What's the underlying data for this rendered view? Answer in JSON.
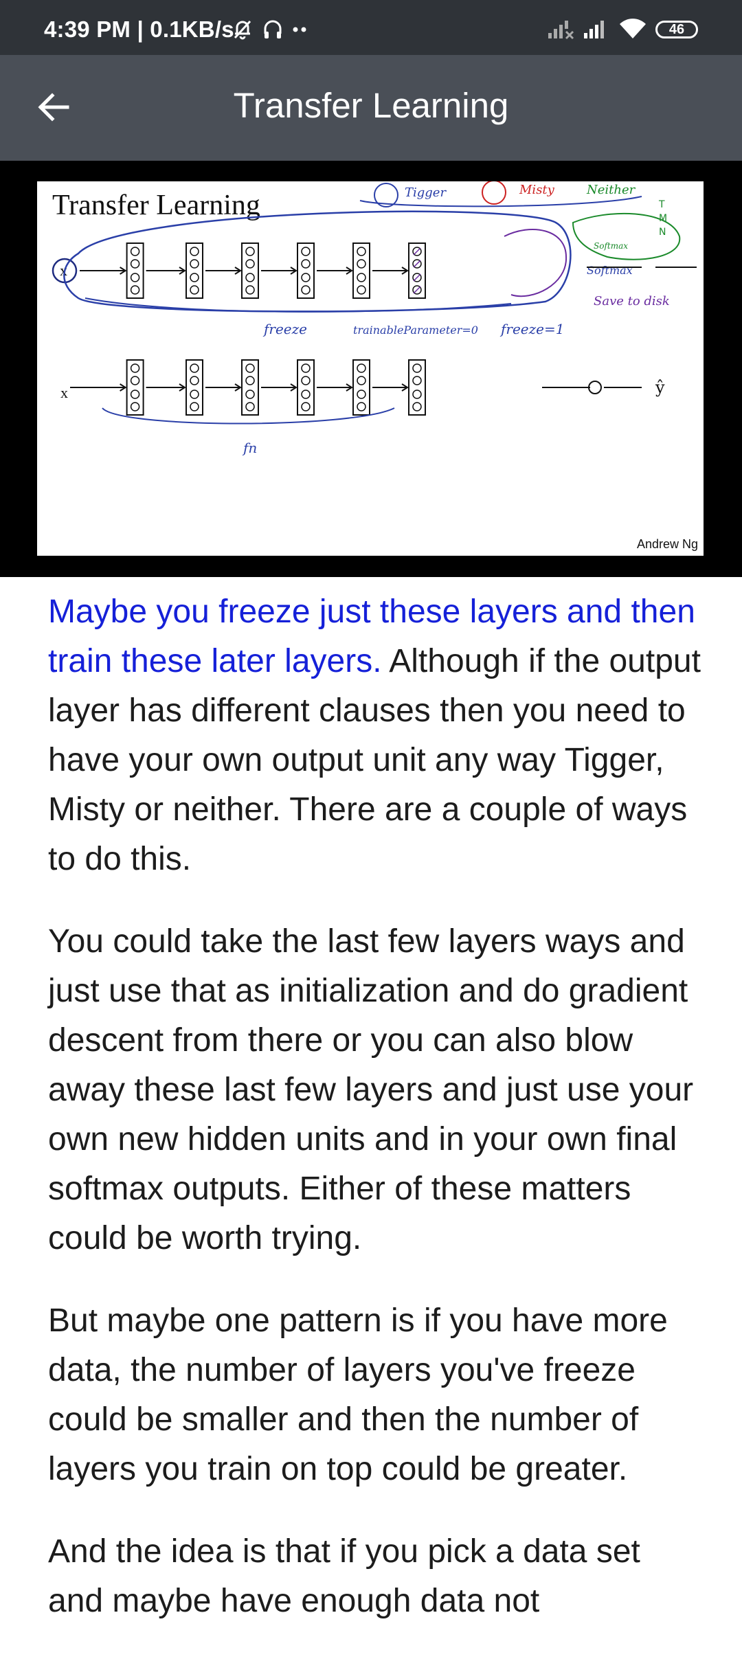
{
  "status_bar": {
    "time": "4:39 PM | 0.1KB/s",
    "battery": "46",
    "icons": [
      "muted-bell-icon",
      "headphones-icon",
      "more-dots-icon",
      "signal-x-icon",
      "signal-icon",
      "wifi-icon",
      "battery-icon"
    ]
  },
  "app_bar": {
    "title": "Transfer Learning",
    "back_icon": "arrow-left-icon"
  },
  "slide": {
    "title": "Transfer Learning",
    "credit": "Andrew Ng",
    "annotations": {
      "tigger": "Tigger",
      "misty": "Misty",
      "neither": "Neither",
      "t": "T",
      "m": "M",
      "n": "N",
      "softmax_small": "Softmax",
      "softmax": "Softmax",
      "save": "Save to disk",
      "freeze": "freeze",
      "trainable": "trainableParameter=0",
      "freeze1": "freeze=1",
      "fn": "fn"
    },
    "input_label": "x",
    "output_label": "ŷ"
  },
  "paragraphs": [
    {
      "highlight": "Maybe you freeze just these layers and then train these later layers.",
      "text": " Although if the output layer has different clauses then you need to have your own output unit any way Tigger, Misty or neither. There are a couple of ways to do this."
    },
    {
      "text": "You could take the last few layers ways and just use that as initialization and do gradient descent from there or you can also blow away these last few layers and just use your own new hidden units and in your own final softmax outputs. Either of these matters could be worth trying."
    },
    {
      "text": "But maybe one pattern is if you have more data, the number of layers you've freeze could be smaller and then the number of layers you train on top could be greater."
    },
    {
      "text": "And the idea is that if you pick a data set and maybe have enough data not"
    }
  ]
}
